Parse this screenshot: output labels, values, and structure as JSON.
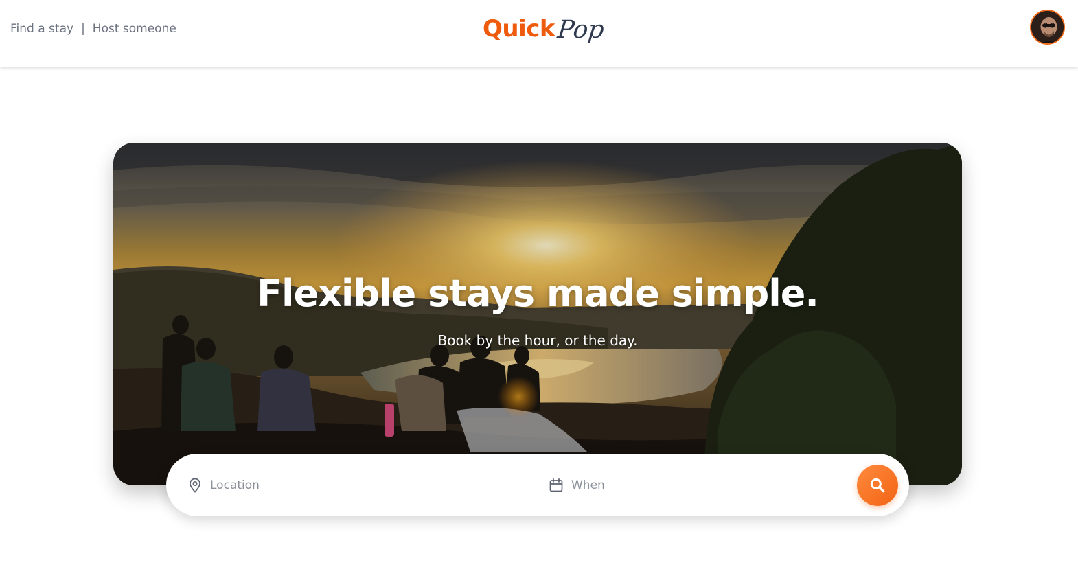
{
  "header": {
    "nav": {
      "find_label": "Find a stay",
      "separator": "|",
      "host_label": "Host someone"
    },
    "logo": {
      "part1": "Quick",
      "part2": "Pop"
    },
    "avatar_icon": "user-avatar"
  },
  "hero": {
    "title": "Flexible stays made simple.",
    "subtitle": "Book by the hour, or the day."
  },
  "search": {
    "location_placeholder": "Location",
    "location_icon": "map-pin-icon",
    "when_placeholder": "When",
    "when_icon": "calendar-icon",
    "button_icon": "search-icon"
  },
  "colors": {
    "accent": "#ef5b0c",
    "logo_dark": "#2f3a4f",
    "nav_text": "#6b7280"
  }
}
